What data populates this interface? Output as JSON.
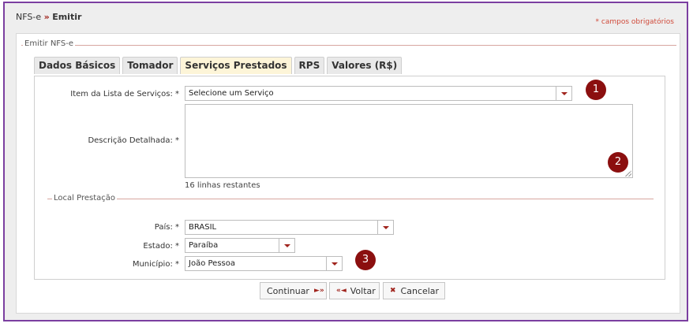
{
  "breadcrumb": {
    "root": "NFS-e",
    "separator": "»",
    "current": "Emitir"
  },
  "required_note": "* campos obrigatórios",
  "fieldset_title": "Emitir NFS-e",
  "tabs": [
    {
      "label": "Dados Básicos"
    },
    {
      "label": "Tomador"
    },
    {
      "label": "Serviços Prestados"
    },
    {
      "label": "RPS"
    },
    {
      "label": "Valores (R$)"
    }
  ],
  "form": {
    "item_label": "Item da Lista de Serviços: *",
    "item_value": "Selecione um Serviço",
    "descricao_label": "Descrição Detalhada: *",
    "descricao_value": "",
    "descricao_hint": "16 linhas restantes",
    "local_title": "Local Prestação",
    "pais_label": "País: *",
    "pais_value": "BRASIL",
    "estado_label": "Estado: *",
    "estado_value": "Paraíba",
    "municipio_label": "Município: *",
    "municipio_value": "João Pessoa"
  },
  "badges": [
    "1",
    "2",
    "3"
  ],
  "buttons": {
    "continuar": "Continuar",
    "continuar_icon": "►»",
    "voltar": "Voltar",
    "voltar_icon": "«◄",
    "cancelar": "Cancelar",
    "cancelar_icon": "✖"
  },
  "colors": {
    "frame": "#7b3fa0",
    "accent": "#a0241d",
    "badge": "#8b0f0f",
    "active_tab": "#fdf5d8"
  }
}
